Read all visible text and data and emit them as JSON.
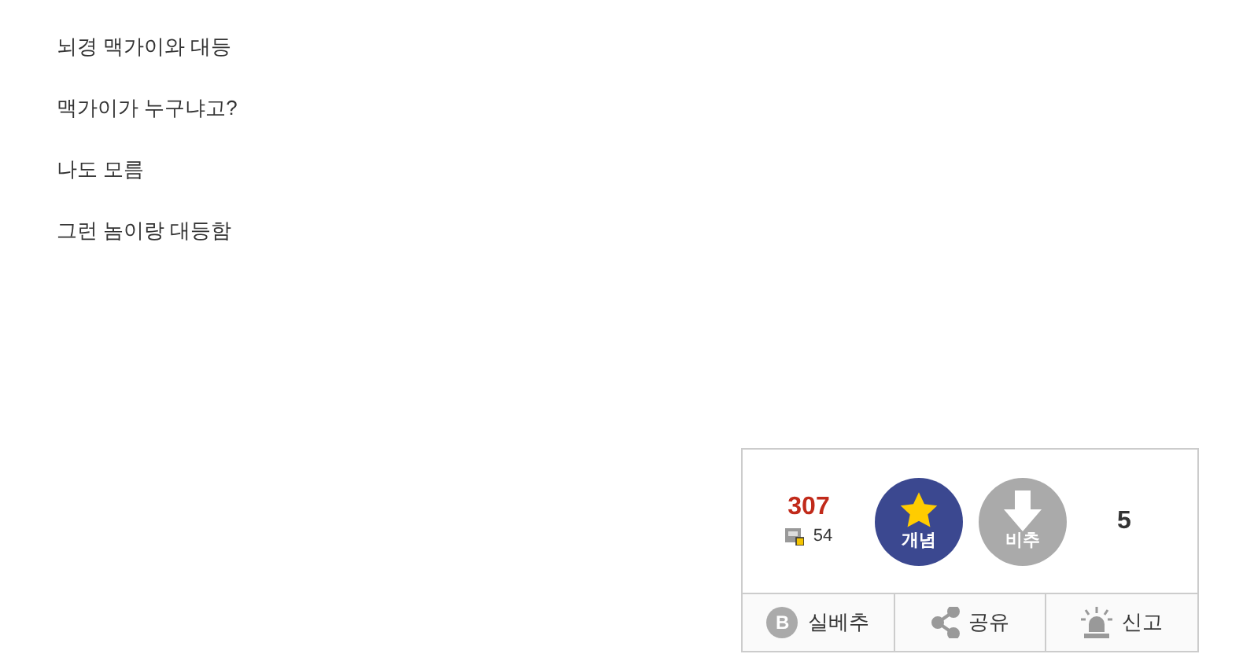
{
  "post_lines": [
    "뇌경 맥가이와 대등",
    "맥가이가 누구냐고?",
    "나도 모름",
    "그런 놈이랑 대등함"
  ],
  "vote": {
    "upvotes": "307",
    "fixed_upvotes": "54",
    "up_label": "개념",
    "down_label": "비추",
    "downvotes": "5"
  },
  "actions": [
    {
      "kind": "badge",
      "badge_letter": "B",
      "label": "실베추"
    },
    {
      "kind": "share",
      "label": "공유"
    },
    {
      "kind": "report",
      "label": "신고"
    }
  ]
}
